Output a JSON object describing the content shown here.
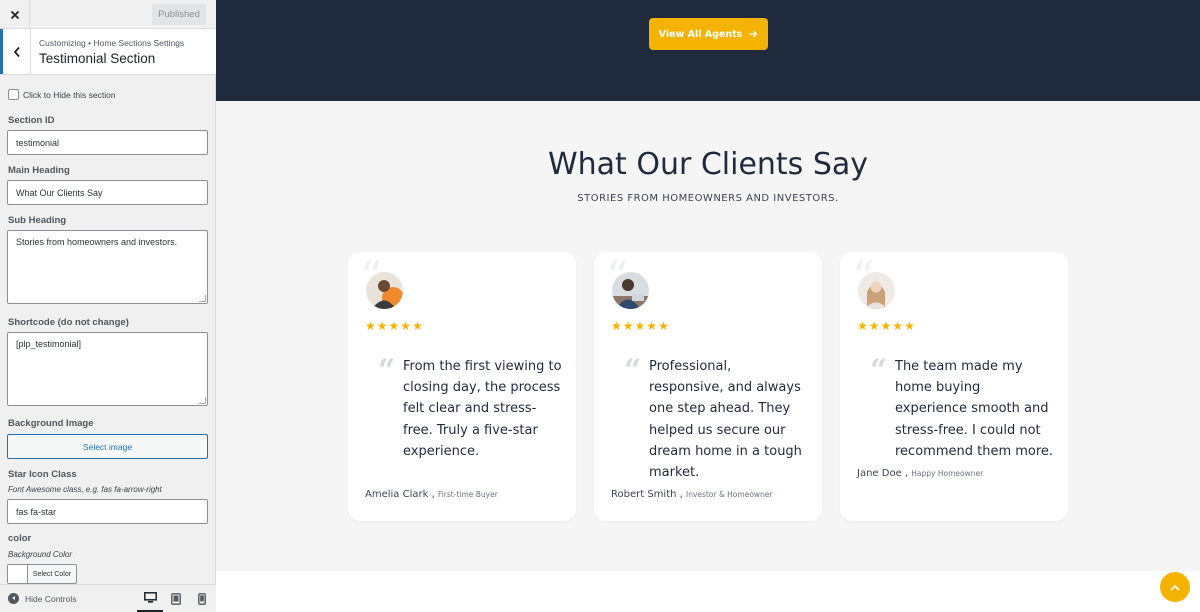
{
  "header": {
    "published_label": "Published",
    "breadcrumb": "Customizing • Home Sections Settings",
    "section_title": "Testimonial Section"
  },
  "controls": {
    "hide_section_label": "Click to Hide this section",
    "section_id": {
      "label": "Section ID",
      "value": "testimonial"
    },
    "main_heading": {
      "label": "Main Heading",
      "value": "What Our Clients Say"
    },
    "sub_heading": {
      "label": "Sub Heading",
      "value": "Stories from homeowners and investors."
    },
    "shortcode": {
      "label": "Shortcode (do not change)",
      "value": "[plp_testimonial]"
    },
    "background_image": {
      "label": "Background Image",
      "button": "Select image"
    },
    "star_icon": {
      "label": "Star Icon Class",
      "description": "Font Awesome class, e.g. fas fa-arrow-right",
      "value": "fas fa-star"
    },
    "color": {
      "label": "color",
      "description": "Background Color",
      "button": "Select Color",
      "value": "#ffffff"
    }
  },
  "footer": {
    "hide_controls_label": "Hide Controls",
    "devices": [
      "desktop",
      "tablet",
      "mobile"
    ],
    "active_device": "desktop"
  },
  "preview": {
    "agents_button": "View All Agents",
    "heading": "What Our Clients Say",
    "subheading": "STORIES FROM HOMEOWNERS AND INVESTORS.",
    "testimonials": [
      {
        "name": "Amelia Clark",
        "role": "First-time Buyer",
        "rating": 5,
        "text": "From the first viewing to closing day, the process felt clear and stress-free. Truly a five-star experience."
      },
      {
        "name": "Robert Smith",
        "role": "Investor & Homeowner",
        "rating": 5,
        "text": "Professional, responsive, and always one step ahead. They helped us secure our dream home in a tough market."
      },
      {
        "name": "Jane Doe",
        "role": "Happy Homeowner",
        "rating": 5,
        "text": "The team made my home buying experience smooth and stress-free. I could not recommend them more."
      }
    ]
  },
  "colors": {
    "accent": "#f5b301",
    "dark_band": "#1f2a3c",
    "wp_blue": "#2271b1"
  }
}
